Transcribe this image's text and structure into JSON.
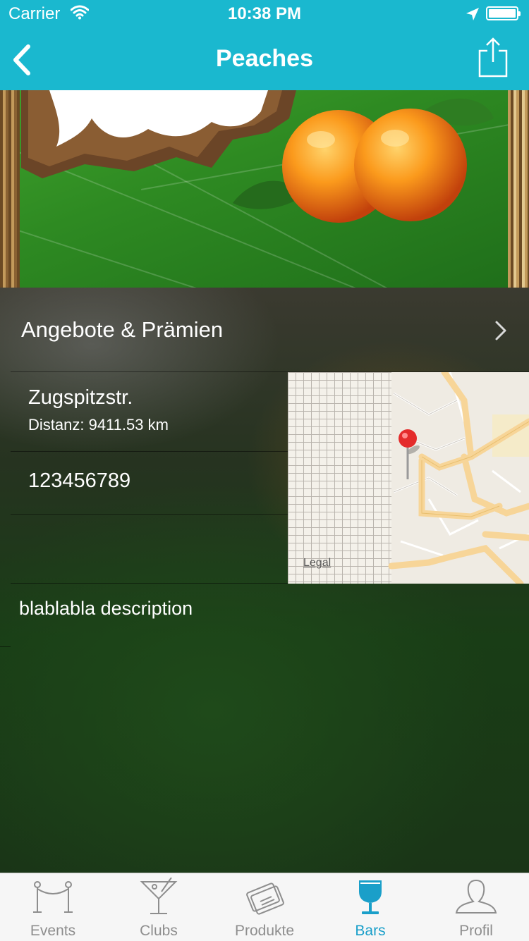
{
  "status_bar": {
    "carrier": "Carrier",
    "time": "10:38 PM"
  },
  "nav": {
    "title": "Peaches",
    "back_icon": "chevron-left-icon",
    "share_icon": "share-icon"
  },
  "colors": {
    "nav_bg": "#1ab8cf",
    "tab_active": "#1a9fc9",
    "tab_inactive": "#8e8e8e"
  },
  "detail": {
    "offers_label": "Angebote & Prämien",
    "street": "Zugspitzstr.",
    "distance": "Distanz: 9411.53 km",
    "phone": "123456789",
    "description": "blablabla description"
  },
  "map": {
    "legal": "Legal"
  },
  "tabs": [
    {
      "label": "Events",
      "icon": "rope-barrier-icon",
      "active": false
    },
    {
      "label": "Clubs",
      "icon": "cocktail-glass-icon",
      "active": false
    },
    {
      "label": "Produkte",
      "icon": "ticket-card-icon",
      "active": false
    },
    {
      "label": "Bars",
      "icon": "wine-glass-icon",
      "active": true
    },
    {
      "label": "Profil",
      "icon": "person-icon",
      "active": false
    }
  ]
}
